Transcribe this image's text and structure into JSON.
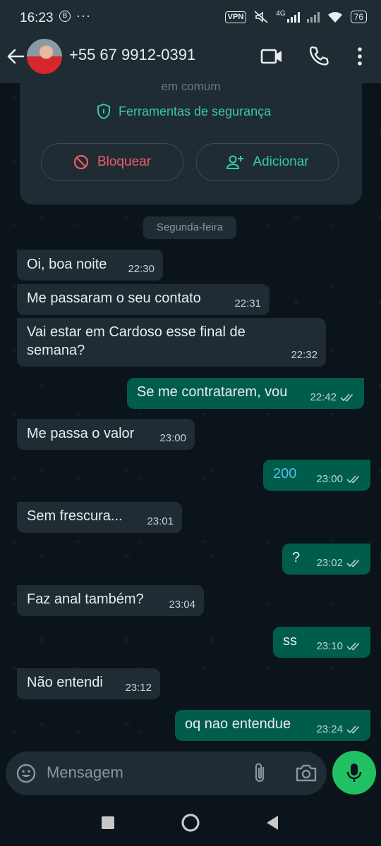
{
  "status_bar": {
    "time": "16:23",
    "left_badge": "B",
    "overflow": "···",
    "vpn": "VPN",
    "network": "4G",
    "battery": "76"
  },
  "header": {
    "contact": "+55 67 9912-0391"
  },
  "info_card": {
    "em_comum": "em comum",
    "safety_tools": "Ferramentas de segurança",
    "block_label": "Bloquear",
    "add_label": "Adicionar"
  },
  "day_label": "Segunda-feira",
  "messages": [
    {
      "dir": "in",
      "text": "Oi, boa noite",
      "time": "22:30"
    },
    {
      "dir": "in",
      "text": "Me passaram o seu contato",
      "time": "22:31"
    },
    {
      "dir": "in",
      "text": "Vai estar em Cardoso esse final de",
      "text2": "semana?",
      "time": "22:32"
    },
    {
      "dir": "out",
      "text": "Se me contratarem, vou",
      "time": "22:42"
    },
    {
      "dir": "in",
      "text": "Me passa o valor",
      "time": "23:00"
    },
    {
      "dir": "out",
      "text": "200",
      "time": "23:00"
    },
    {
      "dir": "in",
      "text": "Sem frescura...",
      "time": "23:01"
    },
    {
      "dir": "out",
      "text": "?",
      "time": "23:02"
    },
    {
      "dir": "in",
      "text": "Faz anal também?",
      "time": "23:04"
    },
    {
      "dir": "out",
      "text": "ss",
      "time": "23:10"
    },
    {
      "dir": "in",
      "text": "Não entendi",
      "time": "23:12"
    },
    {
      "dir": "out",
      "text": "oq nao entendue",
      "time": "23:24"
    }
  ],
  "composer": {
    "placeholder": "Mensagem"
  },
  "colors": {
    "accent": "#21c063",
    "outgoing_bubble": "#005c4b",
    "incoming_bubble": "#1f2c34",
    "danger": "#f15c6d"
  }
}
